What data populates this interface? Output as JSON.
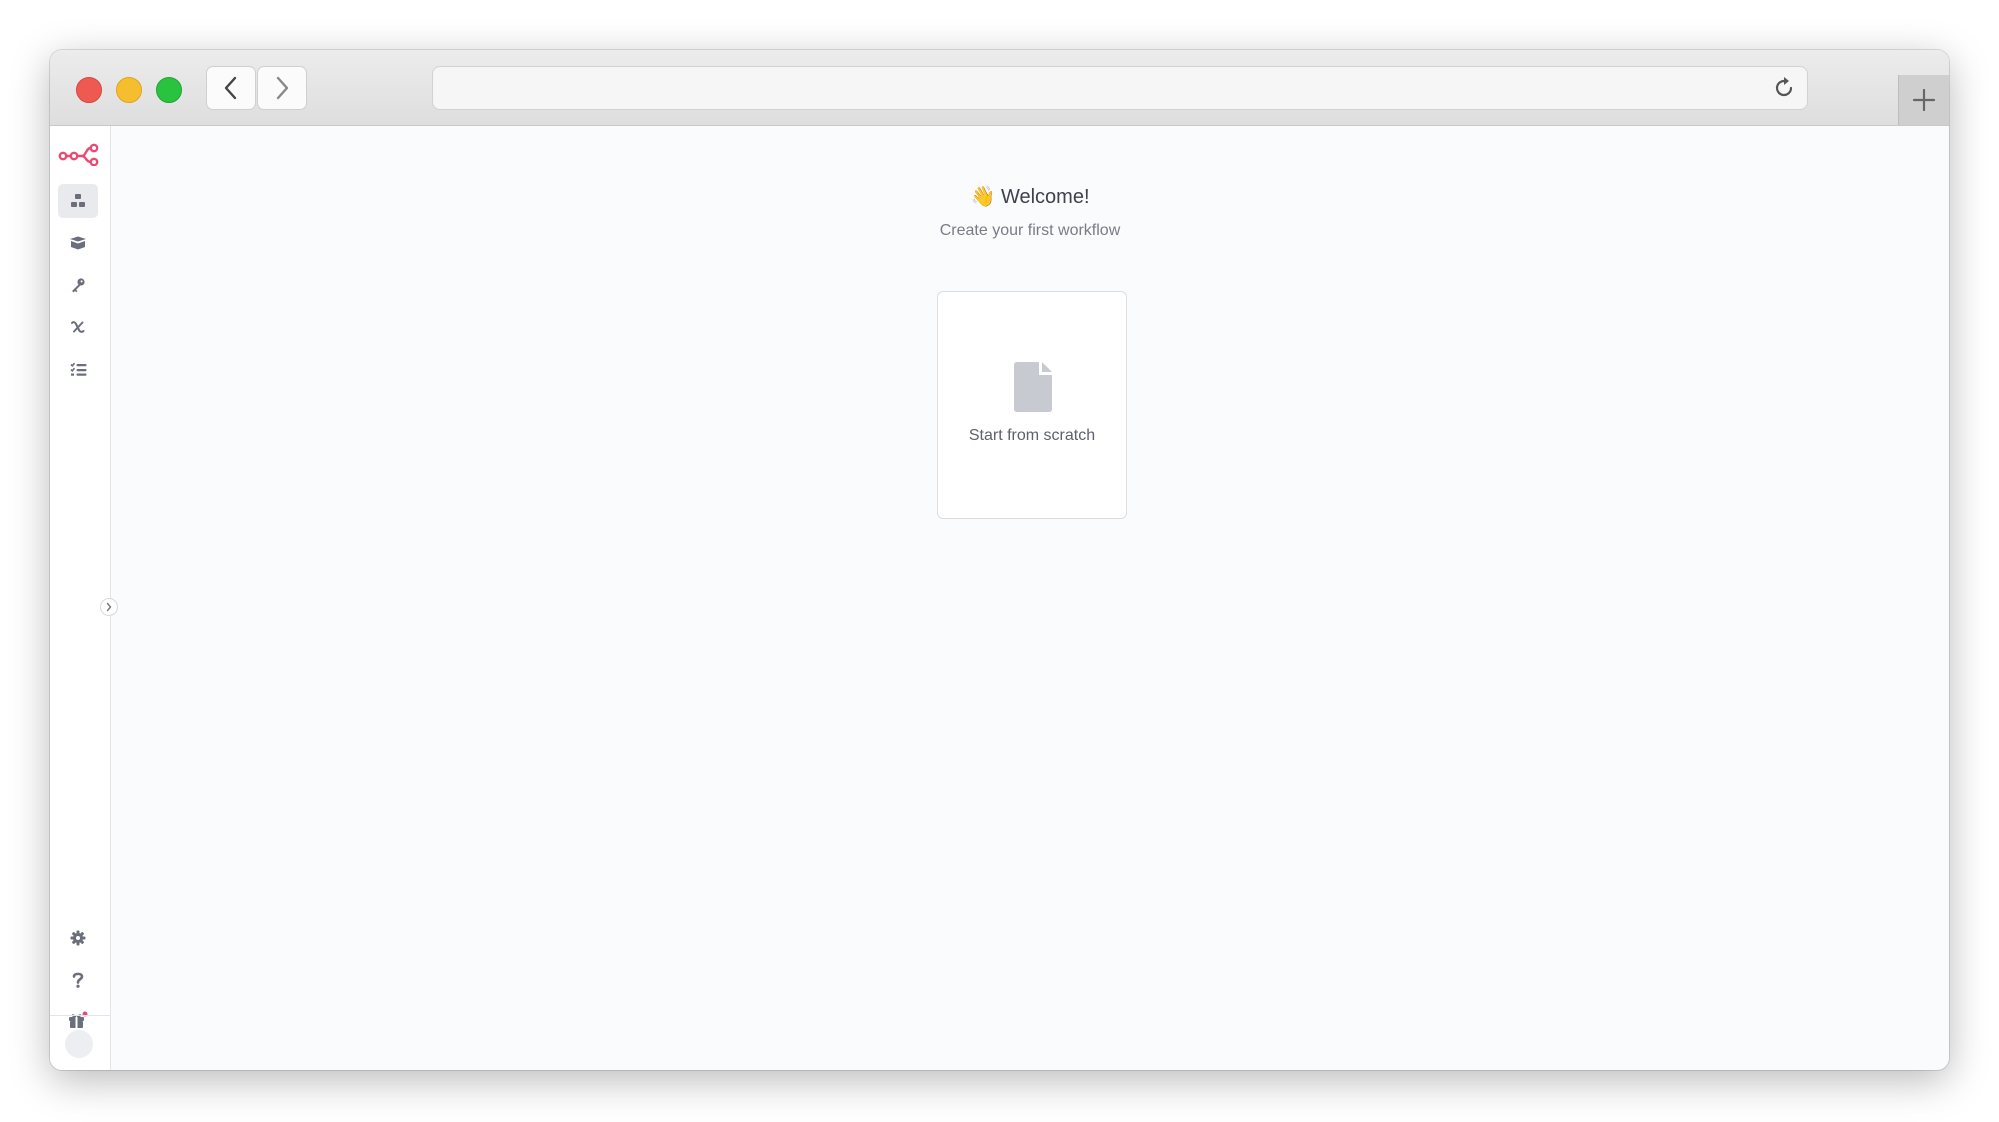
{
  "main": {
    "welcome_emoji": "👋",
    "welcome_title": "Welcome!",
    "subtitle": "Create your first workflow",
    "card_label": "Start from scratch"
  },
  "sidebar": {
    "items": [
      "workflows-icon",
      "templates-icon",
      "credentials-icon",
      "variables-icon",
      "executions-icon"
    ],
    "bottom_items": [
      "settings-icon",
      "help-icon",
      "gift-icon"
    ]
  },
  "colors": {
    "brand": "#ea4b71",
    "icon": "#6b6f7b",
    "active_bg": "#e8eaee",
    "card_icon": "#c8cad1"
  }
}
